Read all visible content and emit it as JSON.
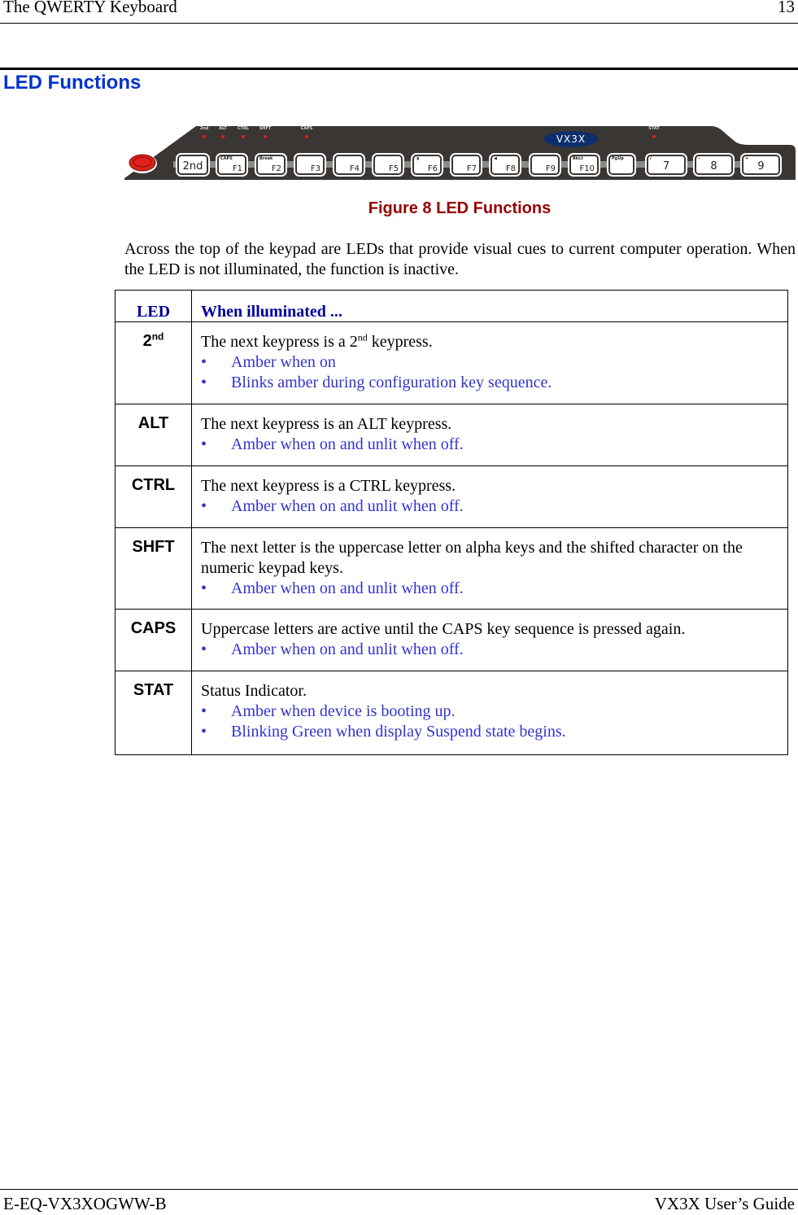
{
  "header": {
    "title": "The QWERTY Keyboard",
    "page": "13"
  },
  "section": {
    "title": "LED Functions"
  },
  "keypad": {
    "logo": "VX3X",
    "led_labels": [
      "2nd",
      "ALT",
      "CTRL",
      "SHFT",
      "CAPS",
      "STAT"
    ],
    "keys": [
      {
        "main": "2nd",
        "sub": ""
      },
      {
        "main": "F1",
        "sub": "CAPS"
      },
      {
        "main": "F2",
        "sub": "Break"
      },
      {
        "main": "F3",
        "sub": ""
      },
      {
        "main": "F4",
        "sub": ""
      },
      {
        "main": "F5",
        "sub": ""
      },
      {
        "main": "F6",
        "sub": "◑"
      },
      {
        "main": "F7",
        "sub": ""
      },
      {
        "main": "F8",
        "sub": "◀"
      },
      {
        "main": "F9",
        "sub": ""
      },
      {
        "main": "F10",
        "sub": "BkLt"
      },
      {
        "main": "",
        "sub": "PgUp"
      },
      {
        "main": "7",
        "sub": "/"
      },
      {
        "main": "8",
        "sub": "-"
      },
      {
        "main": "9",
        "sub": "+"
      }
    ],
    "colors": {
      "body": "#3a3634",
      "led": "#e0201a",
      "power": "#e0201a",
      "logo": "#0e2f6e"
    }
  },
  "figure": {
    "caption": "Figure 8  LED Functions"
  },
  "intro": "Across the top of the keypad are LEDs that provide visual cues to current computer operation. When the LED is not illuminated, the function is inactive.",
  "table": {
    "headers": [
      "LED",
      "When illuminated ..."
    ],
    "rows": [
      {
        "led": "2",
        "led_sup": "nd",
        "desc_pre": "The next keypress is a 2",
        "desc_sup": "nd",
        "desc_post": " keypress.",
        "bullets": [
          "Amber when on",
          "Blinks amber during configuration key sequence."
        ]
      },
      {
        "led": "ALT",
        "desc": "The  next keypress is an ALT keypress.",
        "bullets": [
          "Amber when on and unlit when off."
        ]
      },
      {
        "led": "CTRL",
        "desc": "The next keypress is a CTRL keypress.",
        "bullets": [
          "Amber when on and unlit when off."
        ]
      },
      {
        "led": "SHFT",
        "desc": "The next letter is the uppercase letter on alpha keys and the shifted character on the numeric keypad keys.",
        "bullets": [
          "Amber when on and unlit when off."
        ]
      },
      {
        "led": "CAPS",
        "desc": "Uppercase letters are active until the CAPS key sequence is pressed again.",
        "bullets": [
          "Amber when on and unlit when off."
        ]
      },
      {
        "led": "STAT",
        "desc": "Status Indicator.",
        "bullets": [
          "Amber when device is booting up.",
          "Blinking Green when display Suspend state begins."
        ]
      }
    ]
  },
  "footer": {
    "left": "E-EQ-VX3XOGWW-B",
    "right": "VX3X User’s Guide"
  }
}
